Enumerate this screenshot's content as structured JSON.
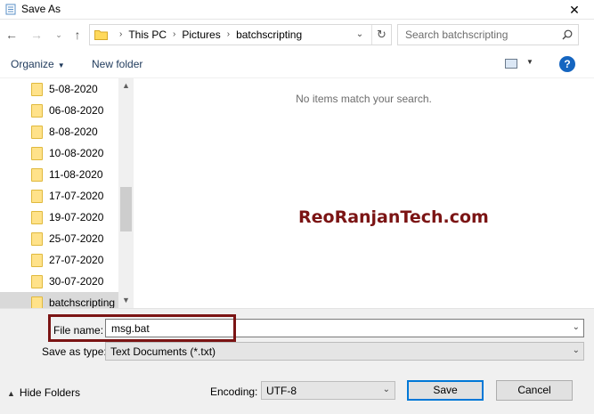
{
  "window": {
    "title": "Save As",
    "close_glyph": "✕"
  },
  "nav": {
    "back_glyph": "←",
    "forward_glyph": "→",
    "recent_glyph": "⌄",
    "up_glyph": "↑",
    "address_crumbs": [
      "This PC",
      "Pictures",
      "batchscripting"
    ],
    "refresh_glyph": "↻",
    "search_placeholder": "Search batchscripting"
  },
  "toolbar": {
    "organize_label": "Organize",
    "new_folder_label": "New folder",
    "help_glyph": "?"
  },
  "sidebar": {
    "items": [
      {
        "label": "5-08-2020"
      },
      {
        "label": "06-08-2020"
      },
      {
        "label": "8-08-2020"
      },
      {
        "label": "10-08-2020"
      },
      {
        "label": "11-08-2020"
      },
      {
        "label": "17-07-2020"
      },
      {
        "label": "19-07-2020"
      },
      {
        "label": "25-07-2020"
      },
      {
        "label": "27-07-2020"
      },
      {
        "label": "30-07-2020"
      },
      {
        "label": "batchscripting",
        "selected": true
      }
    ]
  },
  "content": {
    "empty_message": "No items match your search.",
    "watermark": "ReoRanjanTech.com"
  },
  "form": {
    "file_name_label": "File name:",
    "file_name_value": "msg.bat",
    "save_as_type_label": "Save as type:",
    "save_as_type_value": "Text Documents (*.txt)",
    "encoding_label": "Encoding:",
    "encoding_value": "UTF-8"
  },
  "footer": {
    "hide_folders_label": "Hide Folders",
    "save_label": "Save",
    "cancel_label": "Cancel"
  },
  "colors": {
    "highlight": "#7b1414",
    "accent": "#0078d7",
    "folder": "#ffe28a"
  }
}
